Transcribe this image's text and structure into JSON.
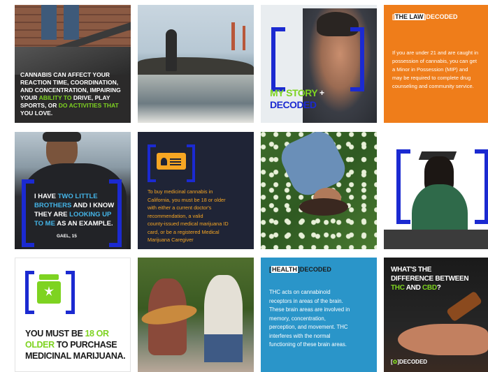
{
  "colors": {
    "accent_blue": "#1b2ad1",
    "green": "#7ed321",
    "orange_tile": "#ef7d1a",
    "navy": "#1f2436",
    "teal": "#2a95c9"
  },
  "tiles": {
    "t1": {
      "lines": [
        "CANNABIS CAN AFFECT YOUR",
        "REACTION TIME, COORDINATION,",
        "AND CONCENTRATION, IMPAIRING",
        "YOUR ",
        "ABILITY TO",
        " DRIVE, PLAY",
        "SPORTS, OR ",
        "DO ACTIVITIES THAT",
        "YOU LOVE."
      ]
    },
    "t3": {
      "line1": "MY STORY",
      "line2": "DECODED",
      "plus": "+"
    },
    "t4": {
      "tag_a": "THE LAW",
      "tag_b": "DECODED",
      "para": [
        "If you are under 21 and are caught in",
        "possession of cannabis, you can get",
        "a Minor in Possession (MIP) and",
        "may be required to complete drug",
        "counseling and community service."
      ]
    },
    "t5": {
      "quote": [
        "I HAVE ",
        "TWO LITTLE",
        "BROTHERS",
        " AND I KNOW",
        "THEY ARE ",
        "LOOKING UP",
        "TO ME",
        " AS AN EXAMPLE."
      ],
      "author": "GAEL, 15"
    },
    "t6": {
      "para": [
        "To buy medicinal cannabis in",
        "California, you must be 18 or older",
        "with either a current doctor's",
        "recommendation, a valid",
        "county-issued medical marijuana ID",
        "card, or be a registered Medical",
        "Marijuana Caregiver"
      ]
    },
    "t9": {
      "line1a": "YOU MUST BE ",
      "line1b": "18 OR",
      "line2a": "OLDER",
      " line2b": " TO PURCHASE",
      "line3": "MEDICINAL MARIJUANA."
    },
    "t11": {
      "tag_a": "HEALTH",
      "tag_b": "DECODED",
      "para": [
        "THC acts on cannabinoid",
        "receptors in areas of the brain.",
        "These brain areas are involved in",
        "memory, concentration,",
        "perception, and movement. THC",
        "interferes with the normal",
        "functioning of these brain areas."
      ]
    },
    "t12": {
      "title": [
        "WHAT'S THE",
        "DIFFERENCE BETWEEN",
        "THC",
        " AND ",
        "CBD",
        "?"
      ],
      "badge": "DECODED"
    }
  },
  "icons": [
    "id-card-icon",
    "cannabis-jar-icon",
    "leaf-icon"
  ]
}
